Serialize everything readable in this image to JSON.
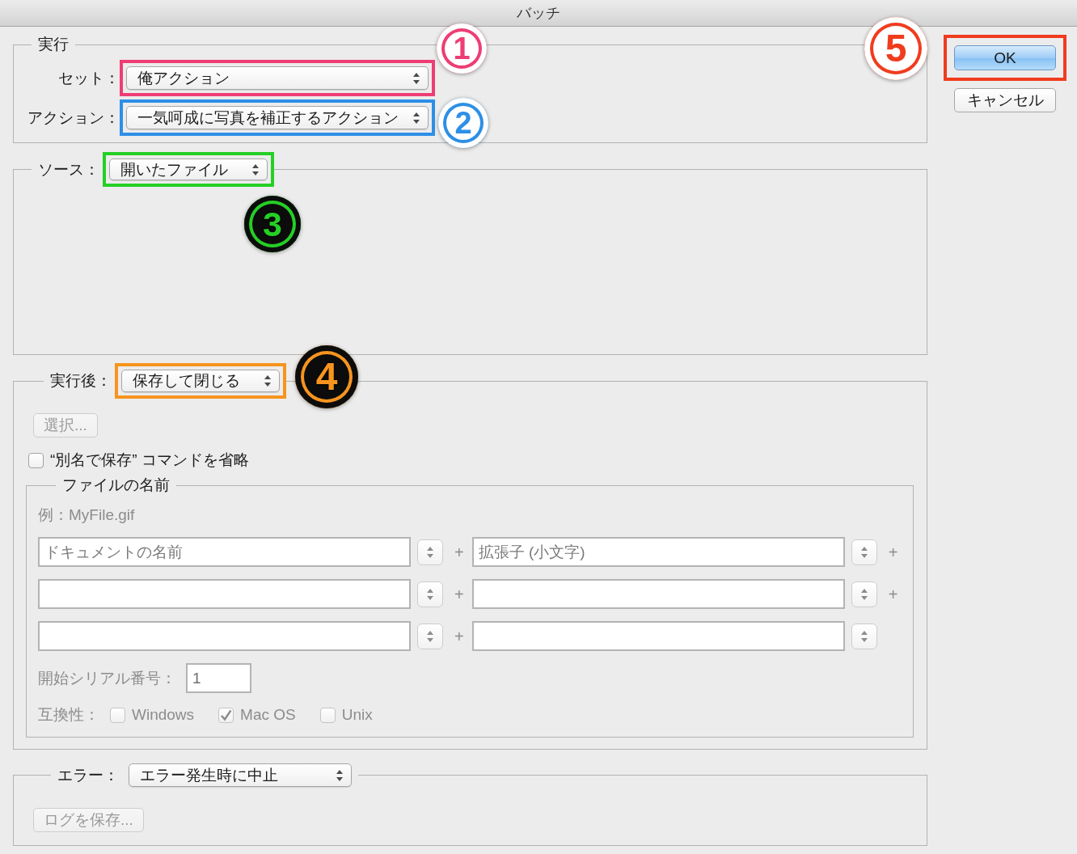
{
  "window": {
    "title": "バッチ"
  },
  "play": {
    "legend": "実行",
    "rows": [
      {
        "label": "セット：",
        "value": "俺アクション",
        "annotation": {
          "number": "1",
          "color": "#ee3d74",
          "kind": "light"
        }
      },
      {
        "label": "アクション：",
        "value": "一気呵成に写真を補正するアクション",
        "annotation": {
          "number": "2",
          "color": "#2d8fe6",
          "kind": "light"
        }
      }
    ]
  },
  "source": {
    "label": "ソース：",
    "value": "開いたファイル",
    "annotation": {
      "number": "3",
      "color": "#25cf25",
      "kind": "dark"
    }
  },
  "destination": {
    "label": "実行後：",
    "value": "保存して閉じる",
    "annotation": {
      "number": "4",
      "color": "#f7941e",
      "kind": "dark"
    },
    "choose_button": {
      "label": "選択...",
      "disabled": true
    },
    "override_save_as": {
      "label": "“別名で保存” コマンドを省略",
      "checked": false
    },
    "file_naming": {
      "legend": "ファイルの名前",
      "disabled": true,
      "example": "例：MyFile.gif",
      "rows": [
        {
          "left": "ドキュメントの名前",
          "joiner": "+",
          "right": "拡張子 (小文字)",
          "trailer": "+"
        },
        {
          "joiner": "+",
          "trailer": "+"
        },
        {
          "joiner": "+"
        }
      ],
      "serial": {
        "label": "開始シリアル番号：",
        "value": "1"
      },
      "compatibility": {
        "label": "互換性：",
        "options": [
          {
            "label": "Windows",
            "checked": false
          },
          {
            "label": "Mac OS",
            "checked": true
          },
          {
            "label": "Unix",
            "checked": false
          }
        ]
      }
    }
  },
  "errors": {
    "label": "エラー：",
    "value": "エラー発生時に中止",
    "save_log_button": {
      "label": "ログを保存...",
      "disabled": true
    }
  },
  "buttons": [
    {
      "label": "OK",
      "default": true,
      "annotation": {
        "number": "5",
        "color": "#f03c1e",
        "kind": "light"
      }
    },
    {
      "label": "キャンセル",
      "default": false
    }
  ]
}
